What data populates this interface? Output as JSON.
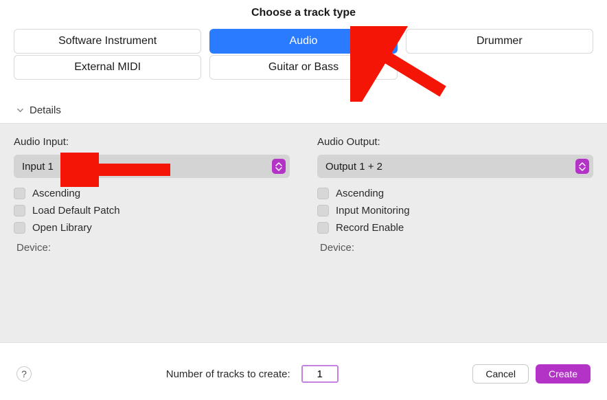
{
  "title": "Choose a track type",
  "trackTypes": {
    "softwareInstrument": "Software Instrument",
    "audio": "Audio",
    "drummer": "Drummer",
    "externalMidi": "External MIDI",
    "guitarOrBass": "Guitar or Bass"
  },
  "details": {
    "toggleLabel": "Details",
    "input": {
      "label": "Audio Input:",
      "value": "Input 1",
      "ascending": "Ascending",
      "loadDefaultPatch": "Load Default Patch",
      "openLibrary": "Open Library",
      "deviceLabel": "Device:"
    },
    "output": {
      "label": "Audio Output:",
      "value": "Output 1 + 2",
      "ascending": "Ascending",
      "inputMonitoring": "Input Monitoring",
      "recordEnable": "Record Enable",
      "deviceLabel": "Device:"
    }
  },
  "footer": {
    "helpGlyph": "?",
    "numberLabel": "Number of tracks to create:",
    "numberValue": "1",
    "cancel": "Cancel",
    "create": "Create"
  },
  "colors": {
    "accent": "#b233c6",
    "selected": "#2a7bff",
    "panel": "#ececec",
    "annotation": "#f41506"
  }
}
